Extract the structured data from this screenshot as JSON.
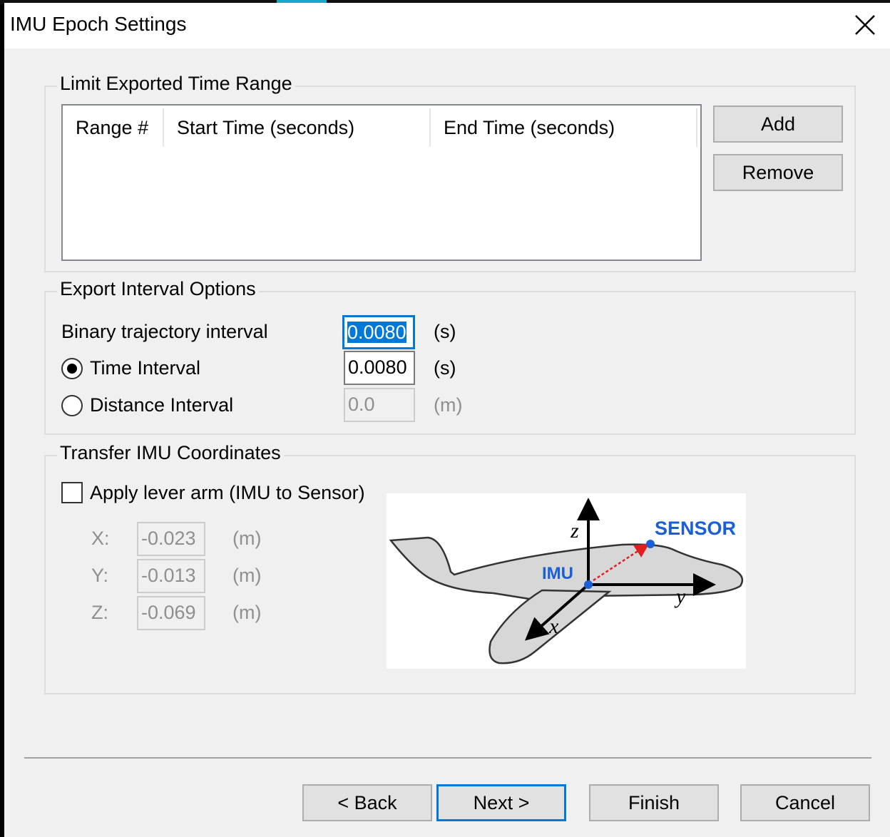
{
  "window": {
    "title": "IMU Epoch Settings"
  },
  "time_range": {
    "group_label": "Limit Exported Time Range",
    "columns": [
      "Range #",
      "Start Time (seconds)",
      "End Time (seconds)"
    ],
    "rows": [],
    "add_label": "Add",
    "remove_label": "Remove"
  },
  "interval": {
    "group_label": "Export Interval Options",
    "binary_label": "Binary trajectory interval",
    "binary_value": "0.0080",
    "binary_unit": "(s)",
    "time_label": "Time Interval",
    "time_value": "0.0080",
    "time_unit": "(s)",
    "time_selected": true,
    "distance_label": "Distance Interval",
    "distance_value": "0.0",
    "distance_unit": "(m)"
  },
  "transfer": {
    "group_label": "Transfer IMU Coordinates",
    "lever_label": "Apply lever arm (IMU to Sensor)",
    "lever_checked": false,
    "x_label": "X:",
    "x_value": "-0.023",
    "x_unit": "(m)",
    "y_label": "Y:",
    "y_value": "-0.013",
    "y_unit": "(m)",
    "z_label": "Z:",
    "z_value": "-0.069",
    "z_unit": "(m)"
  },
  "diagram": {
    "sensor_label": "SENSOR",
    "imu_label": "IMU",
    "axis_x": "x",
    "axis_y": "y",
    "axis_z": "z",
    "label_color": "#1a5fd6"
  },
  "footer": {
    "back_label": "< Back",
    "next_label": "Next >",
    "finish_label": "Finish",
    "cancel_label": "Cancel"
  }
}
